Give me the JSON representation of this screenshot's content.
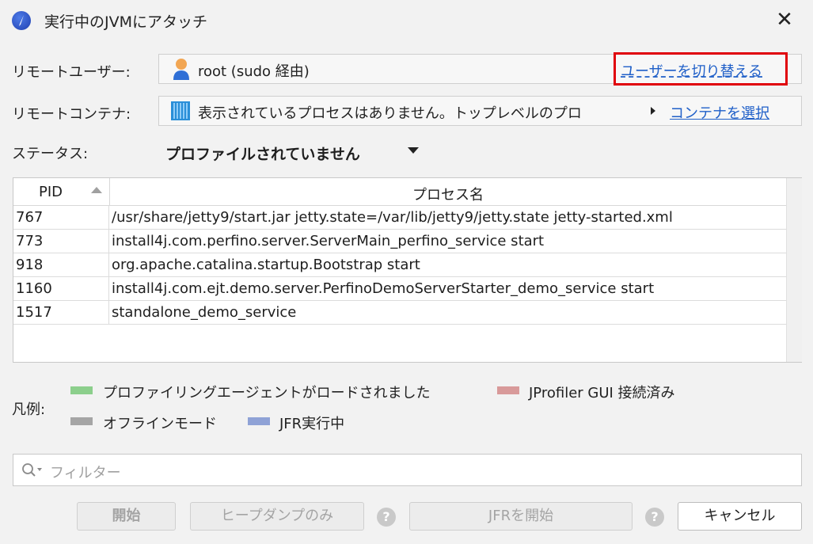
{
  "window": {
    "title": "実行中のJVMにアタッチ"
  },
  "remote_user": {
    "label": "リモートユーザー:",
    "value": "root (sudo 経由)",
    "switch_link": "ユーザーを切り替える"
  },
  "remote_container": {
    "label": "リモートコンテナ:",
    "value": "表示されているプロセスはありません。トップレベルのプロ",
    "select_link": "コンテナを選択"
  },
  "status": {
    "label": "ステータス:",
    "value": "プロファイルされていません"
  },
  "table": {
    "columns": [
      "PID",
      "プロセス名"
    ],
    "rows": [
      {
        "pid": "767",
        "name": "/usr/share/jetty9/start.jar jetty.state=/var/lib/jetty9/jetty.state jetty-started.xml"
      },
      {
        "pid": "773",
        "name": "install4j.com.perfino.server.ServerMain_perfino_service start"
      },
      {
        "pid": "918",
        "name": "org.apache.catalina.startup.Bootstrap start"
      },
      {
        "pid": "1160",
        "name": "install4j.com.ejt.demo.server.PerfinoDemoServerStarter_demo_service start"
      },
      {
        "pid": "1517",
        "name": "standalone_demo_service"
      }
    ]
  },
  "legend": {
    "label": "凡例:",
    "items": [
      {
        "text": "プロファイリングエージェントがロードされました",
        "color": "#8ccf8c"
      },
      {
        "text": "JProfiler GUI 接続済み",
        "color": "#d89a9a"
      },
      {
        "text": "オフラインモード",
        "color": "#a5a5a5"
      },
      {
        "text": "JFR実行中",
        "color": "#8fa2d6"
      }
    ]
  },
  "filter": {
    "placeholder": "フィルター"
  },
  "buttons": {
    "start": "開始",
    "heap_dump": "ヒープダンプのみ",
    "jfr_start": "JFRを開始",
    "cancel": "キャンセル",
    "help": "?"
  }
}
